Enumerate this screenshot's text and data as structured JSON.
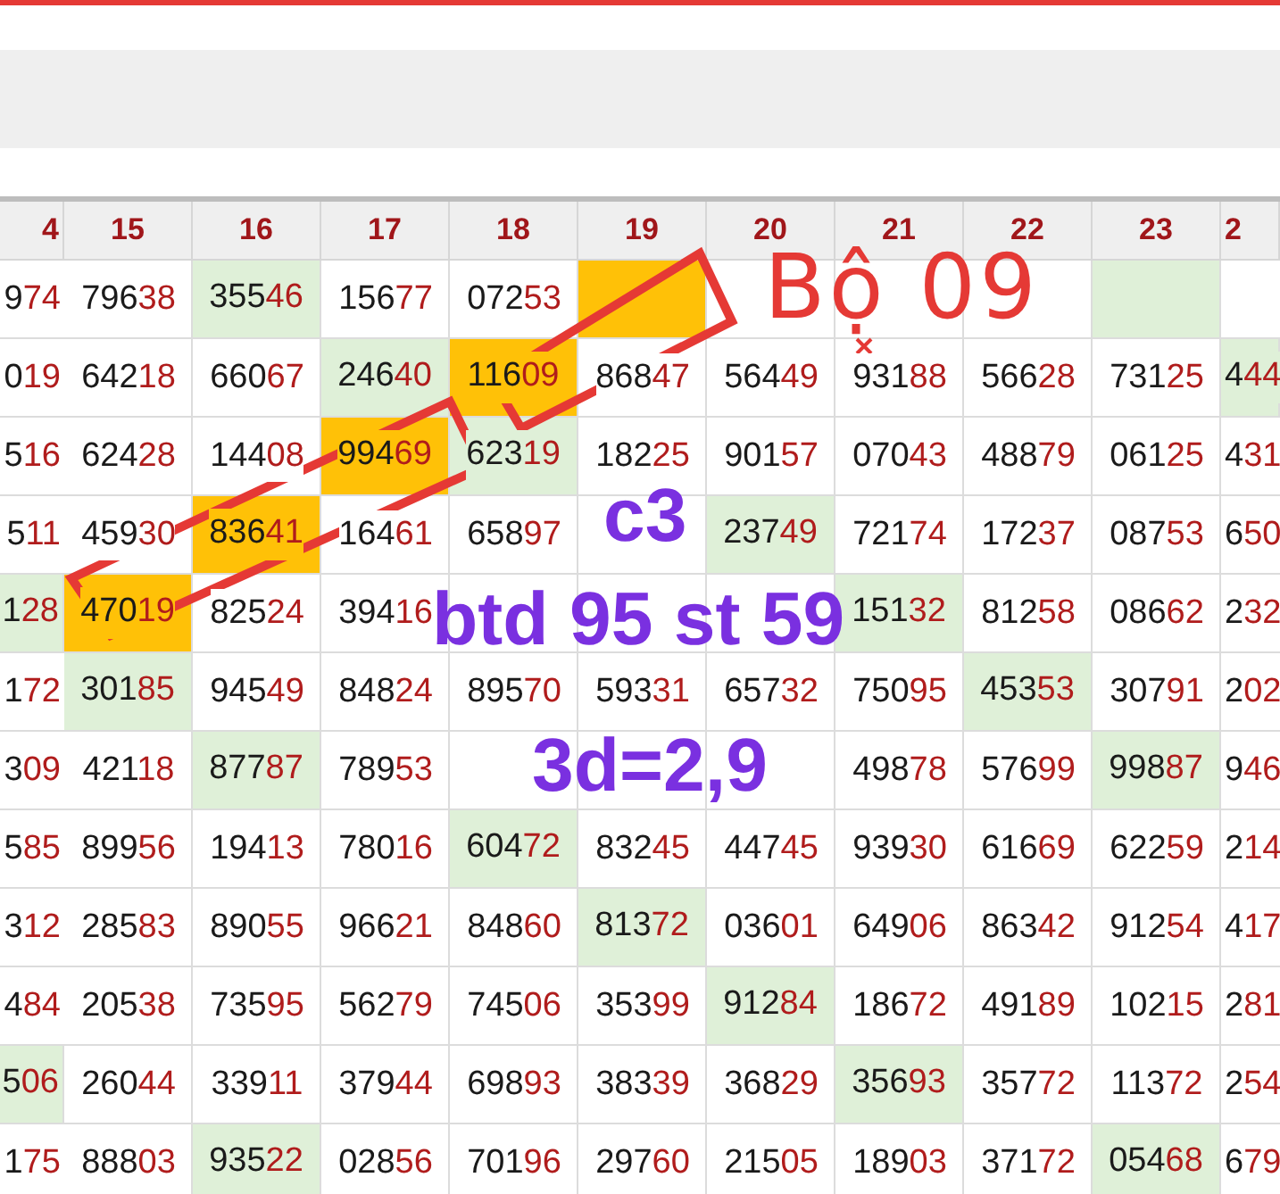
{
  "table": {
    "columns": [
      "4",
      "15",
      "16",
      "17",
      "18",
      "19",
      "20",
      "21",
      "22",
      "23",
      "2"
    ],
    "rows": [
      [
        {
          "v": "974"
        },
        {
          "v": "79638"
        },
        {
          "v": "35546",
          "color": "#dff0d8"
        },
        {
          "v": "15677"
        },
        {
          "v": "07253"
        },
        {
          "color": "#ffc107"
        },
        {},
        {},
        {},
        {
          "color": "#dff0d8"
        },
        {}
      ],
      [
        {
          "v": "019"
        },
        {
          "v": "64218"
        },
        {
          "v": "66067"
        },
        {
          "v": "24640",
          "color": "#dff0d8"
        },
        {
          "v": "11609",
          "color": "#ffc107"
        },
        {
          "v": "86847"
        },
        {
          "v": "56449"
        },
        {
          "v": "93188"
        },
        {
          "v": "56628"
        },
        {
          "v": "73125"
        },
        {
          "v": "444",
          "color": "#dff0d8"
        }
      ],
      [
        {
          "v": "516"
        },
        {
          "v": "62428"
        },
        {
          "v": "14408"
        },
        {
          "v": "99469",
          "color": "#ffc107"
        },
        {
          "v": "62319",
          "color": "#dff0d8"
        },
        {
          "v": "18225"
        },
        {
          "v": "90157"
        },
        {
          "v": "07043"
        },
        {
          "v": "48879"
        },
        {
          "v": "06125"
        },
        {
          "v": "431"
        }
      ],
      [
        {
          "v": "511"
        },
        {
          "v": "45930"
        },
        {
          "v": "83641",
          "color": "#ffc107"
        },
        {
          "v": "16461"
        },
        {
          "v": "65897"
        },
        {},
        {
          "v": "23749",
          "color": "#dff0d8"
        },
        {
          "v": "72174"
        },
        {
          "v": "17237"
        },
        {
          "v": "08753"
        },
        {
          "v": "650"
        }
      ],
      [
        {
          "v": "128",
          "color": "#dff0d8"
        },
        {
          "v": "47019",
          "color": "#ffc107"
        },
        {
          "v": "82524"
        },
        {
          "v": "39416"
        },
        {},
        {},
        {},
        {
          "v": "15132",
          "color": "#dff0d8"
        },
        {
          "v": "81258"
        },
        {
          "v": "08662"
        },
        {
          "v": "232"
        }
      ],
      [
        {
          "v": "172"
        },
        {
          "v": "30185",
          "color": "#dff0d8"
        },
        {
          "v": "94549"
        },
        {
          "v": "84824"
        },
        {
          "v": "89570"
        },
        {
          "v": "59331"
        },
        {
          "v": "65732"
        },
        {
          "v": "75095"
        },
        {
          "v": "45353",
          "color": "#dff0d8"
        },
        {
          "v": "30791"
        },
        {
          "v": "202"
        }
      ],
      [
        {
          "v": "309"
        },
        {
          "v": "42118"
        },
        {
          "v": "87787",
          "color": "#dff0d8"
        },
        {
          "v": "78953"
        },
        {},
        {},
        {},
        {
          "v": "49878"
        },
        {
          "v": "57699"
        },
        {
          "v": "99887",
          "color": "#dff0d8"
        },
        {
          "v": "946"
        }
      ],
      [
        {
          "v": "585"
        },
        {
          "v": "89956"
        },
        {
          "v": "19413"
        },
        {
          "v": "78016"
        },
        {
          "v": "60472",
          "color": "#dff0d8"
        },
        {
          "v": "83245"
        },
        {
          "v": "44745"
        },
        {
          "v": "93930"
        },
        {
          "v": "61669"
        },
        {
          "v": "62259"
        },
        {
          "v": "214"
        }
      ],
      [
        {
          "v": "312"
        },
        {
          "v": "28583"
        },
        {
          "v": "89055"
        },
        {
          "v": "96621"
        },
        {
          "v": "84860"
        },
        {
          "v": "81372",
          "color": "#dff0d8"
        },
        {
          "v": "03601"
        },
        {
          "v": "64906"
        },
        {
          "v": "86342"
        },
        {
          "v": "91254"
        },
        {
          "v": "417"
        }
      ],
      [
        {
          "v": "484"
        },
        {
          "v": "20538"
        },
        {
          "v": "73595"
        },
        {
          "v": "56279"
        },
        {
          "v": "74506"
        },
        {
          "v": "35399"
        },
        {
          "v": "91284",
          "color": "#dff0d8"
        },
        {
          "v": "18672"
        },
        {
          "v": "49189"
        },
        {
          "v": "10215"
        },
        {
          "v": "281"
        }
      ],
      [
        {
          "v": "506",
          "color": "#dff0d8"
        },
        {
          "v": "26044"
        },
        {
          "v": "33911"
        },
        {
          "v": "37944"
        },
        {
          "v": "69893"
        },
        {
          "v": "38339"
        },
        {
          "v": "36829"
        },
        {
          "v": "35693",
          "color": "#dff0d8"
        },
        {
          "v": "35772"
        },
        {
          "v": "11372"
        },
        {
          "v": "254"
        }
      ],
      [
        {
          "v": "175"
        },
        {
          "v": "88803"
        },
        {
          "v": "93522",
          "color": "#dff0d8"
        },
        {
          "v": "02856"
        },
        {
          "v": "70196"
        },
        {
          "v": "29760"
        },
        {
          "v": "21505"
        },
        {
          "v": "18903"
        },
        {
          "v": "37172"
        },
        {
          "v": "05468",
          "color": "#dff0d8"
        },
        {
          "v": "679"
        }
      ]
    ]
  },
  "annotations": [
    {
      "kind": "handwriting",
      "text": "Bộ 09"
    },
    {
      "kind": "marker",
      "text": "c3"
    },
    {
      "kind": "marker",
      "text": "btd 95 st 59"
    },
    {
      "kind": "marker",
      "text": "3d=2,9"
    }
  ]
}
